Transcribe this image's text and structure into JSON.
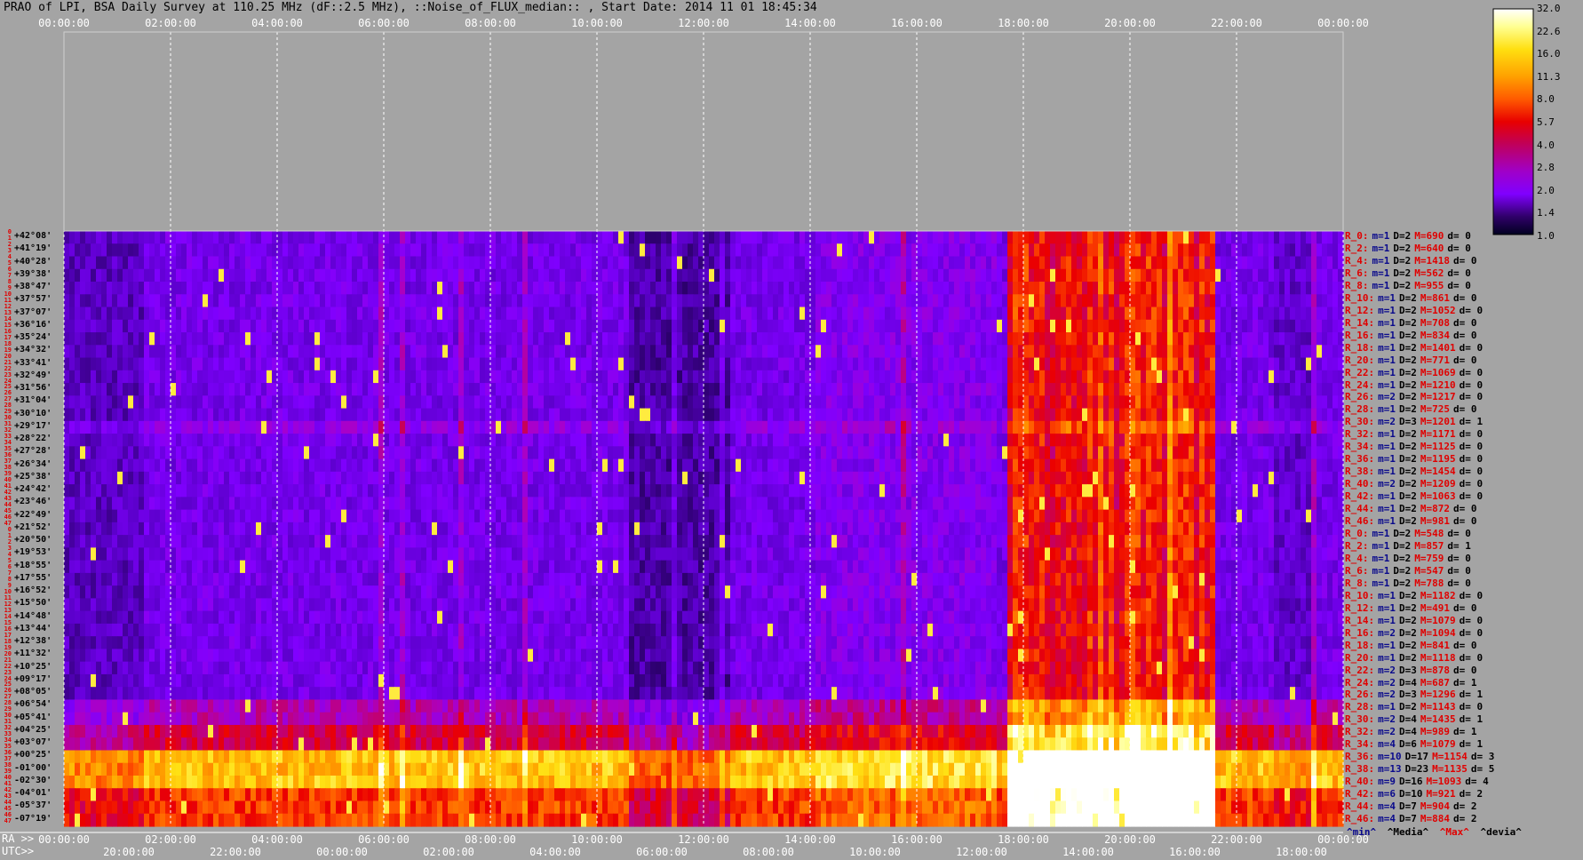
{
  "title": "PRAO of LPI, BSA Daily Survey at 110.25 MHz (dF::2.5 MHz), ::Noise_of_FLUX_median:: , Start Date: 2014 11 01 18:45:34",
  "top_axis_ticks": [
    "00:00:00",
    "02:00:00",
    "04:00:00",
    "06:00:00",
    "08:00:00",
    "10:00:00",
    "12:00:00",
    "14:00:00",
    "16:00:00",
    "18:00:00",
    "20:00:00",
    "22:00:00",
    "00:00:00"
  ],
  "ra_label": "RA >>",
  "utc_label": "UTC>>",
  "bottom_ra_ticks": [
    "00:00:00",
    "02:00:00",
    "04:00:00",
    "06:00:00",
    "08:00:00",
    "10:00:00",
    "12:00:00",
    "14:00:00",
    "16:00:00",
    "18:00:00",
    "20:00:00",
    "22:00:00",
    "00:00:00"
  ],
  "bottom_utc_ticks": [
    "20:00:00",
    "22:00:00",
    "00:00:00",
    "02:00:00",
    "04:00:00",
    "06:00:00",
    "08:00:00",
    "10:00:00",
    "12:00:00",
    "14:00:00",
    "16:00:00",
    "18:00:00"
  ],
  "colorbar": {
    "labels": [
      "32.0",
      "22.6",
      "16.0",
      "11.3",
      "8.0",
      "5.7",
      "4.0",
      "2.8",
      "2.0",
      "1.4",
      "1.0"
    ],
    "colors": [
      "#ffffff",
      "#ffff90",
      "#ffdf10",
      "#ffa000",
      "#ff5a00",
      "#e80000",
      "#c0005a",
      "#a000c8",
      "#8000ff",
      "#30006a",
      "#000020"
    ]
  },
  "legend": {
    "min": "^min^",
    "median": "^Media^",
    "max": "^Max^",
    "deviation": "^devia^"
  },
  "row_numbers": [
    "0",
    "1",
    "2",
    "3",
    "4",
    "5",
    "6",
    "7",
    "8",
    "9",
    "10",
    "11",
    "12",
    "13",
    "14",
    "15",
    "16",
    "17",
    "18",
    "19",
    "20",
    "21",
    "22",
    "23",
    "24",
    "25",
    "26",
    "27",
    "28",
    "29",
    "30",
    "31",
    "32",
    "33",
    "34",
    "35",
    "36",
    "37",
    "38",
    "39",
    "40",
    "41",
    "42",
    "43",
    "44",
    "45",
    "46",
    "47",
    "0",
    "1",
    "2",
    "3",
    "4",
    "5",
    "6",
    "7",
    "8",
    "9",
    "10",
    "11",
    "12",
    "13",
    "14",
    "15",
    "16",
    "17",
    "18",
    "19",
    "20",
    "21",
    "22",
    "23",
    "24",
    "25",
    "26",
    "27",
    "28",
    "29",
    "30",
    "31",
    "32",
    "33",
    "34",
    "35",
    "36",
    "37",
    "38",
    "39",
    "40",
    "41",
    "42",
    "43",
    "44",
    "45",
    "46",
    "47"
  ],
  "chart_data": {
    "type": "heatmap",
    "title": "PRAO of LPI, BSA Daily Survey at 110.25 MHz (dF::2.5 MHz), ::Noise_of_FLUX_median:: , Start Date: 2014 11 01 18:45:34",
    "x_axis": "RA / UTC",
    "y_axis": "Declination",
    "color_scale": "log",
    "color_range": [
      1.0,
      32.0
    ],
    "declinations": [
      "+42°08'",
      "+41°19'",
      "+40°28'",
      "+39°38'",
      "+38°47'",
      "+37°57'",
      "+37°07'",
      "+36°16'",
      "+35°24'",
      "+34°32'",
      "+33°41'",
      "+32°49'",
      "+31°56'",
      "+31°04'",
      "+30°10'",
      "+29°17'",
      "+28°22'",
      "+27°28'",
      "+26°34'",
      "+25°38'",
      "+24°42'",
      "+23°46'",
      "+22°49'",
      "+21°52'",
      "+20°50'",
      "+19°53'",
      "+18°55'",
      "+17°55'",
      "+16°52'",
      "+15°50'",
      "+14°48'",
      "+13°44'",
      "+12°38'",
      "+11°32'",
      "+10°25'",
      "+09°17'",
      "+08°05'",
      "+06°54'",
      "+05°41'",
      "+04°25'",
      "+03°07'",
      "+00°25'",
      "-01°00'",
      "-02°30'",
      "-04°01'",
      "-05°37'",
      "-07°19'"
    ],
    "row_stats": [
      {
        "name": "R_0:",
        "min": "m=1",
        "median": "D=2",
        "max": "M=690",
        "dev": "d= 0"
      },
      {
        "name": "R_2:",
        "min": "m=1",
        "median": "D=2",
        "max": "M=640",
        "dev": "d= 0"
      },
      {
        "name": "R_4:",
        "min": "m=1",
        "median": "D=2",
        "max": "M=1418",
        "dev": "d= 0"
      },
      {
        "name": "R_6:",
        "min": "m=1",
        "median": "D=2",
        "max": "M=562",
        "dev": "d= 0"
      },
      {
        "name": "R_8:",
        "min": "m=1",
        "median": "D=2",
        "max": "M=955",
        "dev": "d= 0"
      },
      {
        "name": "R_10:",
        "min": "m=1",
        "median": "D=2",
        "max": "M=861",
        "dev": "d= 0"
      },
      {
        "name": "R_12:",
        "min": "m=1",
        "median": "D=2",
        "max": "M=1052",
        "dev": "d= 0"
      },
      {
        "name": "R_14:",
        "min": "m=1",
        "median": "D=2",
        "max": "M=708",
        "dev": "d= 0"
      },
      {
        "name": "R_16:",
        "min": "m=1",
        "median": "D=2",
        "max": "M=834",
        "dev": "d= 0"
      },
      {
        "name": "R_18:",
        "min": "m=1",
        "median": "D=2",
        "max": "M=1401",
        "dev": "d= 0"
      },
      {
        "name": "R_20:",
        "min": "m=1",
        "median": "D=2",
        "max": "M=771",
        "dev": "d= 0"
      },
      {
        "name": "R_22:",
        "min": "m=1",
        "median": "D=2",
        "max": "M=1069",
        "dev": "d= 0"
      },
      {
        "name": "R_24:",
        "min": "m=1",
        "median": "D=2",
        "max": "M=1210",
        "dev": "d= 0"
      },
      {
        "name": "R_26:",
        "min": "m=2",
        "median": "D=2",
        "max": "M=1217",
        "dev": "d= 0"
      },
      {
        "name": "R_28:",
        "min": "m=1",
        "median": "D=2",
        "max": "M=725",
        "dev": "d= 0"
      },
      {
        "name": "R_30:",
        "min": "m=2",
        "median": "D=3",
        "max": "M=1201",
        "dev": "d= 1"
      },
      {
        "name": "R_32:",
        "min": "m=1",
        "median": "D=2",
        "max": "M=1171",
        "dev": "d= 0"
      },
      {
        "name": "R_34:",
        "min": "m=1",
        "median": "D=2",
        "max": "M=1125",
        "dev": "d= 0"
      },
      {
        "name": "R_36:",
        "min": "m=1",
        "median": "D=2",
        "max": "M=1195",
        "dev": "d= 0"
      },
      {
        "name": "R_38:",
        "min": "m=1",
        "median": "D=2",
        "max": "M=1454",
        "dev": "d= 0"
      },
      {
        "name": "R_40:",
        "min": "m=2",
        "median": "D=2",
        "max": "M=1209",
        "dev": "d= 0"
      },
      {
        "name": "R_42:",
        "min": "m=1",
        "median": "D=2",
        "max": "M=1063",
        "dev": "d= 0"
      },
      {
        "name": "R_44:",
        "min": "m=1",
        "median": "D=2",
        "max": "M=872",
        "dev": "d= 0"
      },
      {
        "name": "R_46:",
        "min": "m=1",
        "median": "D=2",
        "max": "M=981",
        "dev": "d= 0"
      },
      {
        "name": "R_0:",
        "min": "m=1",
        "median": "D=2",
        "max": "M=548",
        "dev": "d= 0"
      },
      {
        "name": "R_2:",
        "min": "m=1",
        "median": "D=2",
        "max": "M=857",
        "dev": "d= 1"
      },
      {
        "name": "R_4:",
        "min": "m=1",
        "median": "D=2",
        "max": "M=759",
        "dev": "d= 0"
      },
      {
        "name": "R_6:",
        "min": "m=1",
        "median": "D=2",
        "max": "M=547",
        "dev": "d= 0"
      },
      {
        "name": "R_8:",
        "min": "m=1",
        "median": "D=2",
        "max": "M=788",
        "dev": "d= 0"
      },
      {
        "name": "R_10:",
        "min": "m=1",
        "median": "D=2",
        "max": "M=1182",
        "dev": "d= 0"
      },
      {
        "name": "R_12:",
        "min": "m=1",
        "median": "D=2",
        "max": "M=491",
        "dev": "d= 0"
      },
      {
        "name": "R_14:",
        "min": "m=1",
        "median": "D=2",
        "max": "M=1079",
        "dev": "d= 0"
      },
      {
        "name": "R_16:",
        "min": "m=2",
        "median": "D=2",
        "max": "M=1094",
        "dev": "d= 0"
      },
      {
        "name": "R_18:",
        "min": "m=1",
        "median": "D=2",
        "max": "M=841",
        "dev": "d= 0"
      },
      {
        "name": "R_20:",
        "min": "m=1",
        "median": "D=2",
        "max": "M=1118",
        "dev": "d= 0"
      },
      {
        "name": "R_22:",
        "min": "m=2",
        "median": "D=3",
        "max": "M=878",
        "dev": "d= 0"
      },
      {
        "name": "R_24:",
        "min": "m=2",
        "median": "D=4",
        "max": "M=687",
        "dev": "d= 1"
      },
      {
        "name": "R_26:",
        "min": "m=2",
        "median": "D=3",
        "max": "M=1296",
        "dev": "d= 1"
      },
      {
        "name": "R_28:",
        "min": "m=1",
        "median": "D=2",
        "max": "M=1143",
        "dev": "d= 0"
      },
      {
        "name": "R_30:",
        "min": "m=2",
        "median": "D=4",
        "max": "M=1435",
        "dev": "d= 1"
      },
      {
        "name": "R_32:",
        "min": "m=2",
        "median": "D=4",
        "max": "M=989",
        "dev": "d= 1"
      },
      {
        "name": "R_34:",
        "min": "m=4",
        "median": "D=6",
        "max": "M=1079",
        "dev": "d= 1"
      },
      {
        "name": "R_36:",
        "min": "m=10",
        "median": "D=17",
        "max": "M=1154",
        "dev": "d= 3"
      },
      {
        "name": "R_38:",
        "min": "m=13",
        "median": "D=23",
        "max": "M=1135",
        "dev": "d= 5"
      },
      {
        "name": "R_40:",
        "min": "m=9",
        "median": "D=16",
        "max": "M=1093",
        "dev": "d= 4"
      },
      {
        "name": "R_42:",
        "min": "m=6",
        "median": "D=10",
        "max": "M=921",
        "dev": "d= 2"
      },
      {
        "name": "R_44:",
        "min": "m=4",
        "median": "D=7",
        "max": "M=904",
        "dev": "d= 2"
      },
      {
        "name": "R_46:",
        "min": "m=4",
        "median": "D=7",
        "max": "M=884",
        "dev": "d= 2"
      }
    ]
  }
}
